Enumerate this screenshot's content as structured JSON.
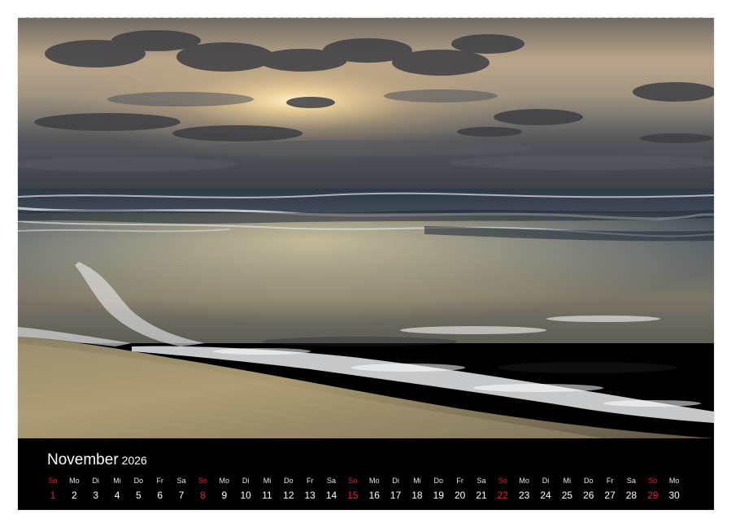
{
  "calendar": {
    "month": "November",
    "year": "2026",
    "days": [
      {
        "weekday": "So",
        "day": "1",
        "sunday": true
      },
      {
        "weekday": "Mo",
        "day": "2"
      },
      {
        "weekday": "Di",
        "day": "3"
      },
      {
        "weekday": "Mi",
        "day": "4"
      },
      {
        "weekday": "Do",
        "day": "5"
      },
      {
        "weekday": "Fr",
        "day": "6"
      },
      {
        "weekday": "Sa",
        "day": "7"
      },
      {
        "weekday": "So",
        "day": "8",
        "sunday": true
      },
      {
        "weekday": "Mo",
        "day": "9"
      },
      {
        "weekday": "Di",
        "day": "10"
      },
      {
        "weekday": "Mi",
        "day": "11"
      },
      {
        "weekday": "Do",
        "day": "12"
      },
      {
        "weekday": "Fr",
        "day": "13"
      },
      {
        "weekday": "Sa",
        "day": "14"
      },
      {
        "weekday": "So",
        "day": "15",
        "sunday": true
      },
      {
        "weekday": "Mo",
        "day": "16"
      },
      {
        "weekday": "Di",
        "day": "17"
      },
      {
        "weekday": "Mi",
        "day": "18"
      },
      {
        "weekday": "Do",
        "day": "19"
      },
      {
        "weekday": "Fr",
        "day": "20"
      },
      {
        "weekday": "Sa",
        "day": "21"
      },
      {
        "weekday": "So",
        "day": "22",
        "sunday": true
      },
      {
        "weekday": "Mo",
        "day": "23"
      },
      {
        "weekday": "Di",
        "day": "24"
      },
      {
        "weekday": "Mi",
        "day": "25"
      },
      {
        "weekday": "Do",
        "day": "26"
      },
      {
        "weekday": "Fr",
        "day": "27"
      },
      {
        "weekday": "Sa",
        "day": "28"
      },
      {
        "weekday": "So",
        "day": "29",
        "sunday": true
      },
      {
        "weekday": "Mo",
        "day": "30"
      }
    ]
  },
  "colors": {
    "sunday": "#e8262b",
    "bar": "#000000",
    "text": "#ffffff"
  },
  "photo": {
    "subject": "beach-sunset-waves"
  }
}
